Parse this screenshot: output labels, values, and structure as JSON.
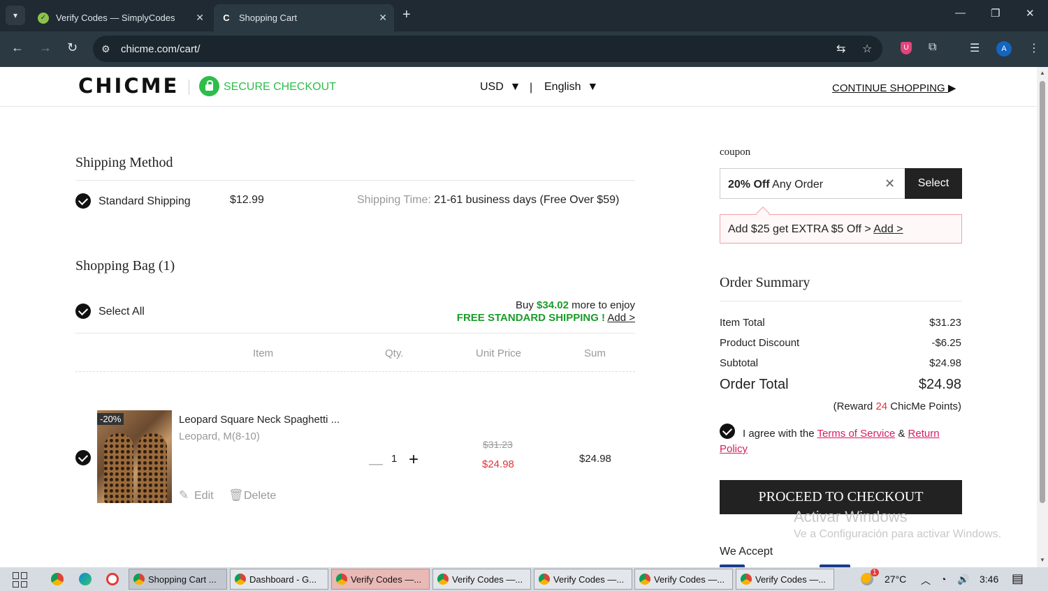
{
  "browser": {
    "tabs": [
      {
        "title": "Verify Codes — SimplyCodes",
        "close": "✕"
      },
      {
        "title": "Shopping Cart",
        "close": "✕"
      }
    ],
    "url": "chicme.com/cart/",
    "profile_initial": "A",
    "ext_badge": "U"
  },
  "header": {
    "logo": "CHICME",
    "secure": "SECURE CHECKOUT",
    "currency": "USD",
    "language": "English",
    "continue": "CONTINUE SHOPPING"
  },
  "shipping": {
    "title": "Shipping Method",
    "method": "Standard Shipping",
    "price": "$12.99",
    "time_label": "Shipping Time:",
    "time_value": "21-61 business days (Free Over $59)"
  },
  "bag": {
    "title": "Shopping Bag (1)",
    "select_all": "Select All",
    "buy_prefix": "Buy",
    "buy_amount": "$34.02",
    "buy_suffix": "more to enjoy",
    "free_shipping": "FREE STANDARD SHIPPING !",
    "add_link": "Add >",
    "columns": [
      "Item",
      "Qty.",
      "Unit Price",
      "Sum"
    ],
    "items": [
      {
        "name": "Leopard Square Neck Spaghetti ...",
        "variant": "Leopard, M(8-10)",
        "discount": "-20%",
        "qty": "1",
        "old_price": "$31.23",
        "price": "$24.98",
        "sum": "$24.98",
        "edit": "Edit",
        "delete": "Delete"
      }
    ]
  },
  "coupon": {
    "label": "coupon",
    "value_bold": "20% Off",
    "value_rest": "Any Order",
    "select": "Select",
    "promo_text": "Add $25 get EXTRA $5 Off >",
    "promo_link": "Add >"
  },
  "summary": {
    "title": "Order Summary",
    "item_total_label": "Item Total",
    "item_total": "$31.23",
    "discount_label": "Product Discount",
    "discount": "-$6.25",
    "subtotal_label": "Subtotal",
    "subtotal": "$24.98",
    "order_total_label": "Order Total",
    "order_total": "$24.98",
    "reward_prefix": "(Reward",
    "reward_points": "24",
    "reward_suffix": "ChicMe Points)",
    "agree_prefix": "I agree with the",
    "terms": "Terms of Service",
    "amp": "&",
    "return_policy_1": "Return",
    "return_policy_2": "Policy",
    "proceed": "PROCEED TO CHECKOUT",
    "we_accept": "We Accept"
  },
  "watermark": {
    "line1": "Activar Windows",
    "line2": "Ve a Configuración para activar Windows."
  },
  "taskbar": {
    "items": [
      "Shopping Cart ...",
      "Dashboard - G...",
      "Verify Codes —...",
      "Verify Codes —...",
      "Verify Codes —...",
      "Verify Codes —...",
      "Verify Codes —..."
    ],
    "temperature": "27°C",
    "time": "3:46",
    "weather_badge": "1"
  }
}
